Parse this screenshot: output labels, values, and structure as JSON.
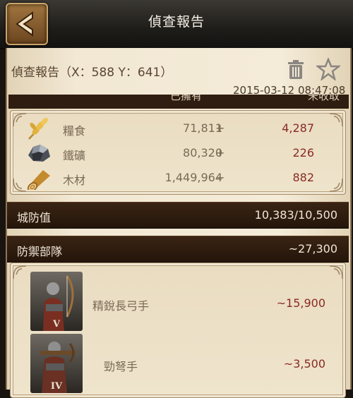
{
  "header": {
    "title": "偵查報告"
  },
  "report": {
    "title": "偵查報告（X：588 Y：641）",
    "timestamp": "2015-03-12  08:47:08"
  },
  "resources": {
    "col_owned": "已擁有",
    "col_uncollected": "未收取",
    "items": [
      {
        "name": "糧食",
        "owned": "71,811",
        "plus": "+",
        "uncollected": "4,287",
        "icon": "wheat-icon"
      },
      {
        "name": "鐵礦",
        "owned": "80,320",
        "plus": "+",
        "uncollected": "226",
        "icon": "iron-ore-icon"
      },
      {
        "name": "木材",
        "owned": "1,449,964",
        "plus": "+",
        "uncollected": "882",
        "icon": "wood-log-icon"
      }
    ]
  },
  "defense": {
    "label": "城防值",
    "value": "10,383/10,500"
  },
  "troops": {
    "label": "防禦部隊",
    "total": "~27,300",
    "items": [
      {
        "name": "精銳長弓手",
        "count": "~15,900",
        "rank": "V",
        "icon": "longbowman-portrait"
      },
      {
        "name": "勁弩手",
        "count": "~3,500",
        "rank": "IV",
        "icon": "crossbowman-portrait"
      }
    ]
  },
  "colors": {
    "accent": "#8a2a24",
    "bar": "#2e1d10",
    "parchment": "#f2e8d4"
  }
}
